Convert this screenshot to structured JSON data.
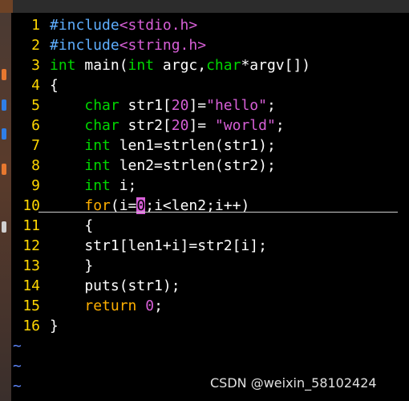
{
  "editor": {
    "lines": [
      {
        "num": "1",
        "parts": [
          {
            "cls": "kw-pre",
            "t": "#include"
          },
          {
            "cls": "str",
            "t": "<stdio.h>"
          }
        ]
      },
      {
        "num": "2",
        "parts": [
          {
            "cls": "kw-pre",
            "t": "#include"
          },
          {
            "cls": "str",
            "t": "<string.h>"
          }
        ]
      },
      {
        "num": "3",
        "parts": [
          {
            "cls": "kw-type",
            "t": "int"
          },
          {
            "cls": "punc",
            "t": " main("
          },
          {
            "cls": "kw-type",
            "t": "int"
          },
          {
            "cls": "punc",
            "t": " argc,"
          },
          {
            "cls": "kw-type",
            "t": "char"
          },
          {
            "cls": "punc",
            "t": "*argv[])"
          }
        ]
      },
      {
        "num": "4",
        "parts": [
          {
            "cls": "punc",
            "t": "{"
          }
        ]
      },
      {
        "num": "5",
        "parts": [
          {
            "cls": "punc",
            "t": "    "
          },
          {
            "cls": "kw-type",
            "t": "char"
          },
          {
            "cls": "punc",
            "t": " str1["
          },
          {
            "cls": "num",
            "t": "20"
          },
          {
            "cls": "punc",
            "t": "]="
          },
          {
            "cls": "str",
            "t": "\"hello\""
          },
          {
            "cls": "punc",
            "t": ";"
          }
        ]
      },
      {
        "num": "6",
        "parts": [
          {
            "cls": "punc",
            "t": "    "
          },
          {
            "cls": "kw-type",
            "t": "char"
          },
          {
            "cls": "punc",
            "t": " str2["
          },
          {
            "cls": "num",
            "t": "20"
          },
          {
            "cls": "punc",
            "t": "]= "
          },
          {
            "cls": "str",
            "t": "\"world\""
          },
          {
            "cls": "punc",
            "t": ";"
          }
        ]
      },
      {
        "num": "7",
        "parts": [
          {
            "cls": "punc",
            "t": "    "
          },
          {
            "cls": "kw-type",
            "t": "int"
          },
          {
            "cls": "punc",
            "t": " len1=strlen(str1);"
          }
        ]
      },
      {
        "num": "8",
        "parts": [
          {
            "cls": "punc",
            "t": "    "
          },
          {
            "cls": "kw-type",
            "t": "int"
          },
          {
            "cls": "punc",
            "t": " len2=strlen(str2);"
          }
        ]
      },
      {
        "num": "9",
        "parts": [
          {
            "cls": "punc",
            "t": "    "
          },
          {
            "cls": "kw-type",
            "t": "int"
          },
          {
            "cls": "punc",
            "t": " i;"
          }
        ]
      },
      {
        "num": "10",
        "parts": [
          {
            "cls": "punc",
            "t": "    "
          },
          {
            "cls": "kw-flow",
            "t": "for"
          },
          {
            "cls": "punc",
            "t": "(i="
          },
          {
            "cls": "cursor-cell",
            "t": "0"
          },
          {
            "cls": "punc",
            "t": ";i<len2;i++)"
          }
        ]
      },
      {
        "num": "11",
        "parts": [
          {
            "cls": "punc",
            "t": "    {"
          }
        ]
      },
      {
        "num": "12",
        "parts": [
          {
            "cls": "punc",
            "t": "    str1[len1+i]=str2[i];"
          }
        ]
      },
      {
        "num": "13",
        "parts": [
          {
            "cls": "punc",
            "t": "    }"
          }
        ]
      },
      {
        "num": "14",
        "parts": [
          {
            "cls": "punc",
            "t": "    puts(str1);"
          }
        ]
      },
      {
        "num": "15",
        "parts": [
          {
            "cls": "punc",
            "t": "    "
          },
          {
            "cls": "kw-flow",
            "t": "return"
          },
          {
            "cls": "punc",
            "t": " "
          },
          {
            "cls": "num",
            "t": "0"
          },
          {
            "cls": "punc",
            "t": ";"
          }
        ]
      },
      {
        "num": "16",
        "parts": [
          {
            "cls": "punc",
            "t": "}"
          }
        ]
      }
    ],
    "tilde_lines": [
      "~",
      "~",
      "~"
    ],
    "colors": {
      "line_number": "#ffd700",
      "type_keyword": "#00d700",
      "preprocessor": "#5fafff",
      "string": "#d75fd7",
      "flow_keyword": "#ffaf00",
      "tilde": "#5f87ff"
    }
  },
  "watermark": "CSDN @weixin_58102424"
}
